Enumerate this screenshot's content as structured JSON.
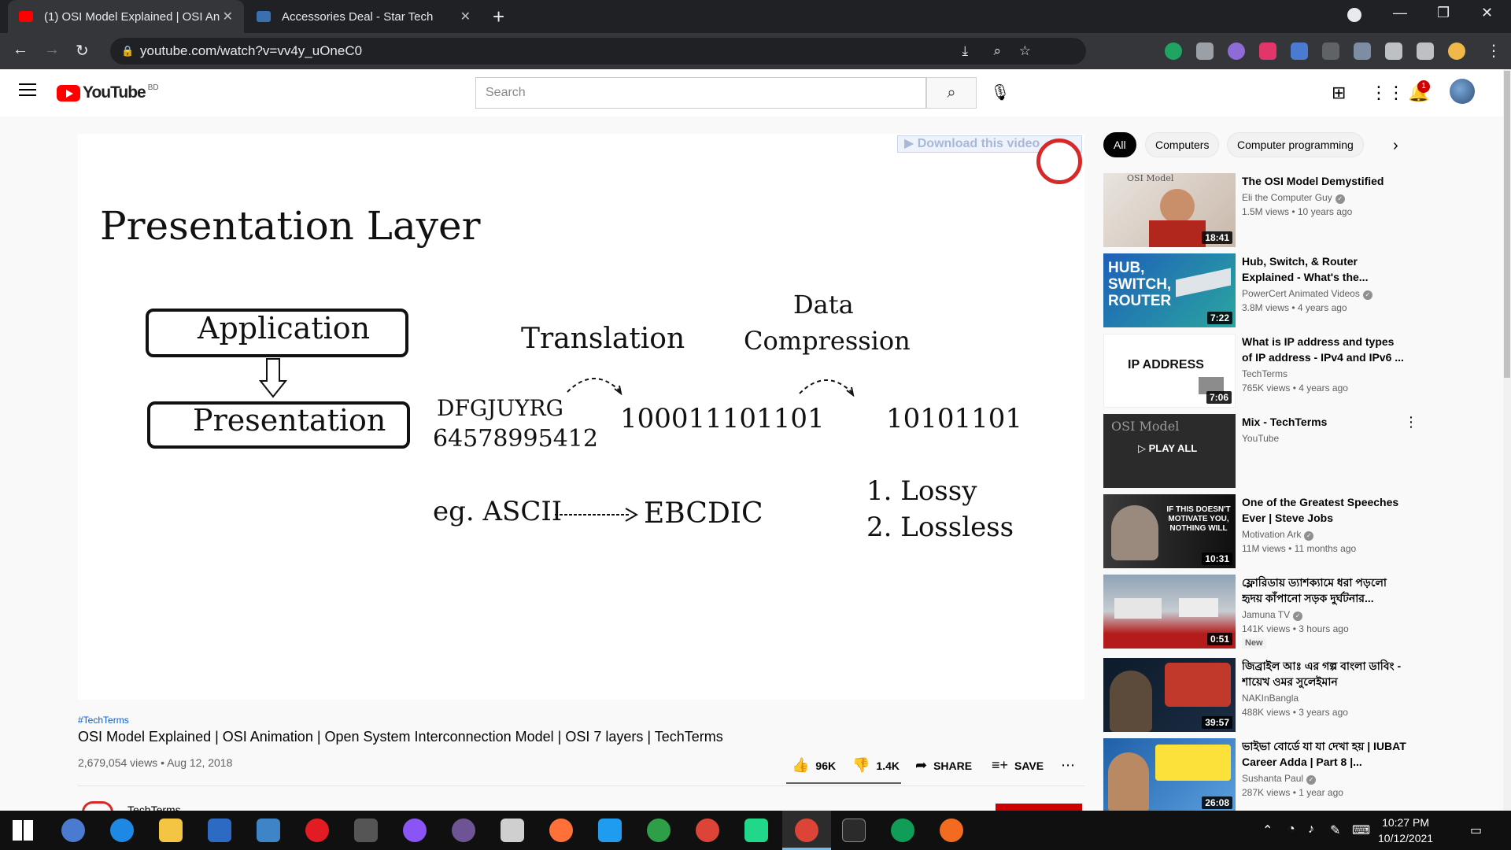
{
  "browser": {
    "tabs": [
      {
        "title": "(1) OSI Model Explained | OSI An",
        "active": true
      },
      {
        "title": "Accessories Deal - Star Tech",
        "active": false
      }
    ],
    "url": "youtube.com/watch?v=vv4y_uOneC0"
  },
  "youtube": {
    "logo_word": "YouTube",
    "country_code": "BD",
    "search_placeholder": "Search",
    "notification_count": "1"
  },
  "video": {
    "overlay_download": "▶ Download this video",
    "slide": {
      "heading": "Presentation Layer",
      "box_top": "Application",
      "box_bottom": "Presentation",
      "translation": "Translation",
      "data_line1": "Data",
      "data_line2": "Compression",
      "sample_text": "DFGJUYRG",
      "sample_number": "64578995412",
      "binary_long": "100011101101",
      "binary_short": "10101101",
      "ascii": "eg. ASCII",
      "ebcdic": "EBCDIC",
      "lossy": "1. Lossy",
      "lossless": "2. Lossless"
    },
    "hashtag": "#TechTerms",
    "title": "OSI Model Explained | OSI Animation | Open System Interconnection Model | OSI 7 layers | TechTerms",
    "views_date": "2,679,054 views • Aug 12, 2018",
    "likes": "96K",
    "dislikes": "1.4K",
    "share": "SHARE",
    "save": "SAVE",
    "channel": "TechTerms"
  },
  "chips": [
    "All",
    "Computers",
    "Computer programming"
  ],
  "recommendations": [
    {
      "title": "The OSI Model Demystified",
      "channel": "Eli the Computer Guy",
      "meta": "1.5M views • 10 years ago",
      "duration": "18:41",
      "verified": true
    },
    {
      "title": "Hub, Switch, & Router Explained - What's the...",
      "channel": "PowerCert Animated Videos",
      "meta": "3.8M views • 4 years ago",
      "duration": "7:22",
      "verified": true
    },
    {
      "title": "What is IP address and types of IP address - IPv4 and IPv6 ...",
      "channel": "TechTerms",
      "meta": "765K views • 4 years ago",
      "duration": "7:06",
      "verified": false
    },
    {
      "title": "Mix - TechTerms",
      "channel": "YouTube",
      "meta": "",
      "duration": "",
      "verified": false,
      "play_all": "PLAY ALL"
    },
    {
      "title": "One of the Greatest Speeches Ever | Steve Jobs",
      "channel": "Motivation Ark",
      "meta": "11M views • 11 months ago",
      "duration": "10:31",
      "verified": true
    },
    {
      "title": "ফ্লোরিডায় ড্যাশক্যামে ধরা পড়লো হৃদয় কাঁপানো সড়ক দুর্ঘটনার...",
      "channel": "Jamuna TV",
      "meta": "141K views • 3 hours ago",
      "duration": "0:51",
      "verified": true,
      "badge": "New"
    },
    {
      "title": "জিব্রাইল আঃ এর গল্প বাংলা ডাবিং - শায়েখ ওমর সুলেইমান",
      "channel": "NAKInBangla",
      "meta": "488K views • 3 years ago",
      "duration": "39:57",
      "verified": false
    },
    {
      "title": "ভাইভা বোর্ডে যা যা দেখা হয় | IUBAT Career Adda | Part 8 |...",
      "channel": "Sushanta Paul",
      "meta": "287K views • 1 year ago",
      "duration": "26:08",
      "verified": true
    }
  ],
  "thumb_text": {
    "osi": "OSI Model",
    "hub": "HUB, SWITCH, ROUTER",
    "ip": "IP ADDRESS",
    "mix": "OSI Model",
    "jobs": "IF THIS DOESN'T MOTIVATE YOU, NOTHING WILL"
  },
  "taskbar": {
    "time": "10:27 PM",
    "date": "10/12/2021"
  },
  "colors": {
    "yt_red": "#ff0000",
    "chrome_dark": "#202124",
    "link_blue": "#065fd4"
  }
}
